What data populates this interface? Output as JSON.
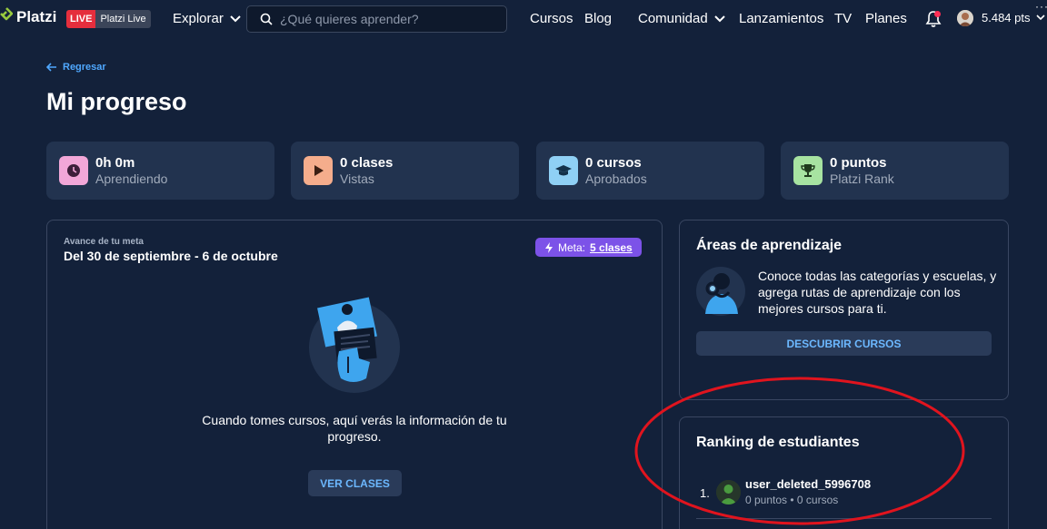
{
  "header": {
    "brand": "Platzi",
    "live_badge": "LIVE",
    "live_label": "Platzi Live",
    "explorar": "Explorar",
    "search_placeholder": "¿Qué quieres aprender?",
    "nav": {
      "cursos": "Cursos",
      "blog": "Blog",
      "comunidad": "Comunidad",
      "lanzamientos": "Lanzamientos",
      "tv": "TV",
      "planes": "Planes"
    },
    "points": "5.484 pts"
  },
  "page": {
    "back": "Regresar",
    "title": "Mi progreso"
  },
  "stats": [
    {
      "value": "0h 0m",
      "label": "Aprendiendo",
      "icon": "clock-icon",
      "color": "#f2a7d8"
    },
    {
      "value": "0 clases",
      "label": "Vistas",
      "icon": "play-icon",
      "color": "#f5ad8c"
    },
    {
      "value": "0 cursos",
      "label": "Aprobados",
      "icon": "graduation-cap-icon",
      "color": "#8fd0f5"
    },
    {
      "value": "0 puntos",
      "label": "Platzi Rank",
      "icon": "trophy-icon",
      "color": "#a7e3a1"
    }
  ],
  "goal": {
    "caption": "Avance de tu meta",
    "range": "Del 30 de septiembre - 6 de octubre",
    "meta_label": "Meta:",
    "meta_value": "5 clases",
    "empty_message": "Cuando tomes cursos, aquí verás la información de tu progreso.",
    "button": "VER CLASES"
  },
  "areas": {
    "title": "Áreas de aprendizaje",
    "text": "Conoce todas las categorías y escuelas, y agrega rutas de aprendizaje con los mejores cursos para ti.",
    "button": "DESCUBRIR CURSOS"
  },
  "ranking": {
    "title": "Ranking de estudiantes",
    "rows": [
      {
        "position": "1.",
        "name": "user_deleted_5996708",
        "stats": "0 puntos • 0 cursos"
      }
    ]
  },
  "colors": {
    "accent": "#4fa8ff",
    "meta_pill": "#7c52e8",
    "annotation_ellipse": "#e0141e"
  }
}
